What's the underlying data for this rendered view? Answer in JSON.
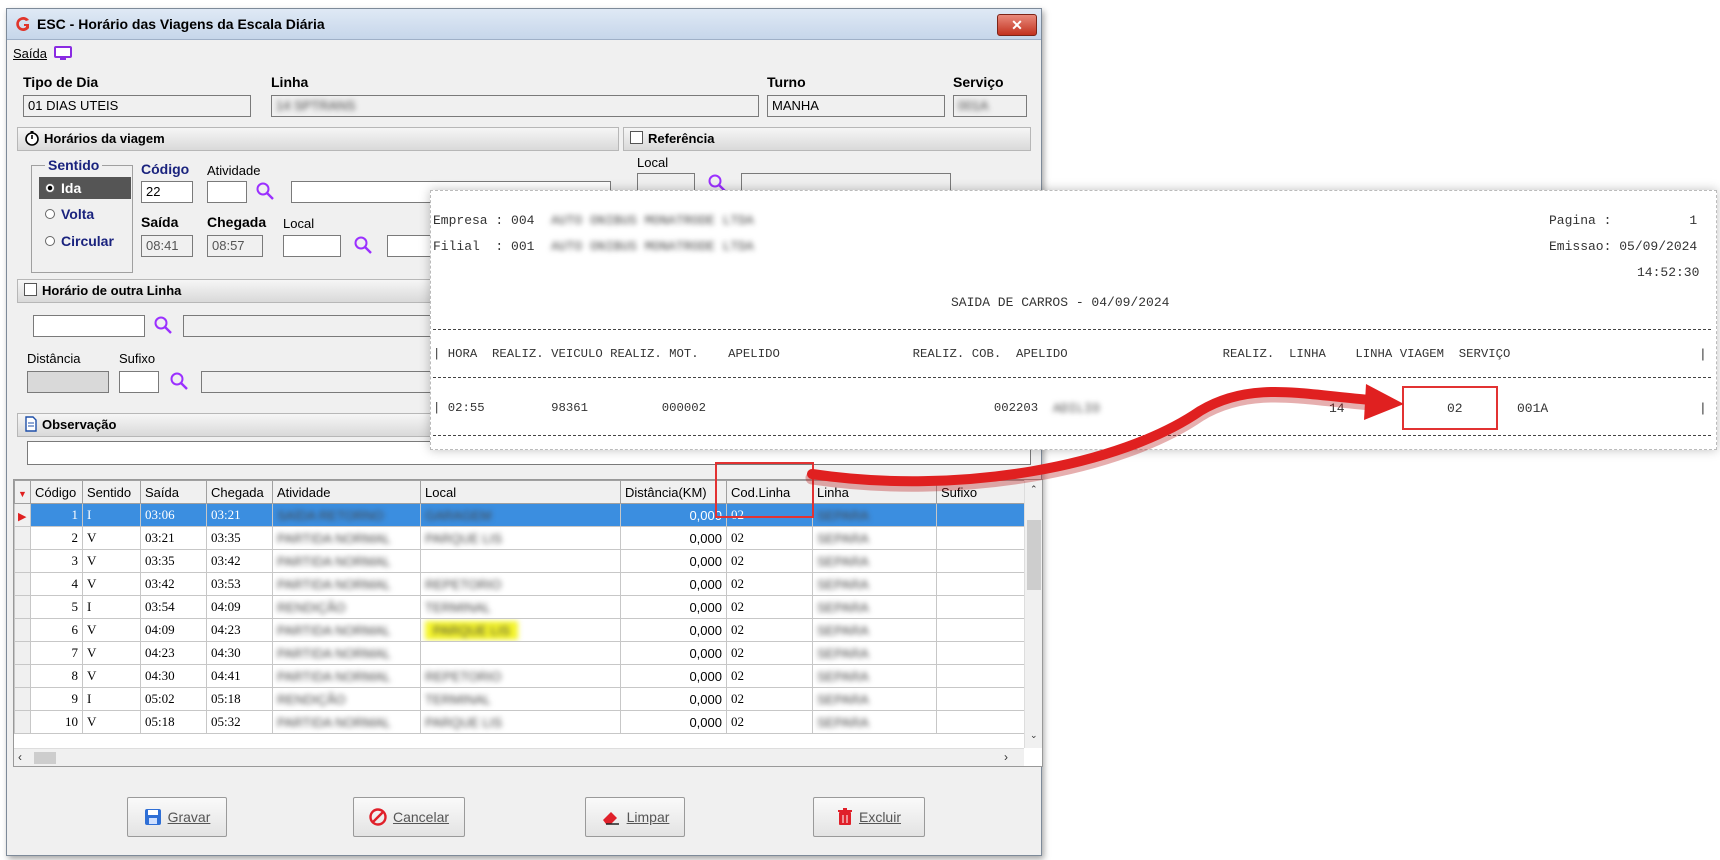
{
  "window": {
    "title": "ESC - Horário das Viagens da Escala Diária",
    "close_label": "✕"
  },
  "menu": {
    "saida_label": "Saída"
  },
  "header": {
    "tipo_dia_label": "Tipo de Dia",
    "tipo_dia_value": "01 DIAS UTEIS",
    "linha_label": "Linha",
    "linha_value": "14 SPTRANS",
    "turno_label": "Turno",
    "turno_value": "MANHA",
    "servico_label": "Serviço",
    "servico_value": "001A"
  },
  "horarios": {
    "title": "Horários da viagem",
    "sentido_label": "Sentido",
    "sentido_options": [
      "Ida",
      "Volta",
      "Circular"
    ],
    "codigo_label": "Código",
    "codigo_value": "22",
    "atividade_label": "Atividade",
    "saida_label": "Saída",
    "saida_value": "08:41",
    "chegada_label": "Chegada",
    "chegada_value": "08:57",
    "local_label": "Local"
  },
  "referencia": {
    "title": "Referência",
    "local_label": "Local"
  },
  "outra_linha": {
    "title": "Horário de outra Linha",
    "distancia_label": "Distância",
    "sufixo_label": "Sufixo"
  },
  "observacao": {
    "title": "Observação"
  },
  "grid": {
    "columns": [
      "Código",
      "Sentido",
      "Saída",
      "Chegada",
      "Atividade",
      "Local",
      "Distância(KM)",
      "Cod.Linha",
      "Linha",
      "Sufixo"
    ],
    "rows": [
      {
        "codigo": "1",
        "sentido": "I",
        "saida": "03:06",
        "chegada": "03:21",
        "atividade": "SAÍDA RETORNO",
        "local": "GARAGEM",
        "distancia": "0,000",
        "cod_linha": "02",
        "linha": "SEPARA"
      },
      {
        "codigo": "2",
        "sentido": "V",
        "saida": "03:21",
        "chegada": "03:35",
        "atividade": "PARTIDA NORMAL",
        "local": "PARQUE LIS",
        "distancia": "0,000",
        "cod_linha": "02",
        "linha": "SEPARA"
      },
      {
        "codigo": "3",
        "sentido": "V",
        "saida": "03:35",
        "chegada": "03:42",
        "atividade": "PARTIDA NORMAL",
        "local": "",
        "distancia": "0,000",
        "cod_linha": "02",
        "linha": "SEPARA"
      },
      {
        "codigo": "4",
        "sentido": "V",
        "saida": "03:42",
        "chegada": "03:53",
        "atividade": "PARTIDA NORMAL",
        "local": "REPETORIO",
        "distancia": "0,000",
        "cod_linha": "02",
        "linha": "SEPARA"
      },
      {
        "codigo": "5",
        "sentido": "I",
        "saida": "03:54",
        "chegada": "04:09",
        "atividade": "RENDIÇÃO",
        "local": "TERMINAL",
        "distancia": "0,000",
        "cod_linha": "02",
        "linha": "SEPARA"
      },
      {
        "codigo": "6",
        "sentido": "V",
        "saida": "04:09",
        "chegada": "04:23",
        "atividade": "PARTIDA NORMAL",
        "local": "PARQUE LIS",
        "distancia": "0,000",
        "cod_linha": "02",
        "linha": "SEPARA"
      },
      {
        "codigo": "7",
        "sentido": "V",
        "saida": "04:23",
        "chegada": "04:30",
        "atividade": "PARTIDA NORMAL",
        "local": "",
        "distancia": "0,000",
        "cod_linha": "02",
        "linha": "SEPARA"
      },
      {
        "codigo": "8",
        "sentido": "V",
        "saida": "04:30",
        "chegada": "04:41",
        "atividade": "PARTIDA NORMAL",
        "local": "REPETORIO",
        "distancia": "0,000",
        "cod_linha": "02",
        "linha": "SEPARA"
      },
      {
        "codigo": "9",
        "sentido": "I",
        "saida": "05:02",
        "chegada": "05:18",
        "atividade": "RENDIÇÃO",
        "local": "TERMINAL",
        "distancia": "0,000",
        "cod_linha": "02",
        "linha": "SEPARA"
      },
      {
        "codigo": "10",
        "sentido": "V",
        "saida": "05:18",
        "chegada": "05:32",
        "atividade": "PARTIDA NORMAL",
        "local": "PARQUE LIS",
        "distancia": "0,000",
        "cod_linha": "02",
        "linha": "SEPARA"
      }
    ]
  },
  "buttons": {
    "gravar": "Gravar",
    "cancelar": "Cancelar",
    "limpar": "Limpar",
    "excluir": "Excluir"
  },
  "report": {
    "empresa": "Empresa : 004",
    "empresa_name": "AUTO ONIBUS MONATRODE LTDA",
    "filial": "Filial  : 001",
    "filial_name": "AUTO ONIBUS MONATRODE LTDA",
    "pagina": "Pagina :          1",
    "emissao": "Emissao: 05/09/2024",
    "hora": "14:52:30",
    "title": "SAIDA DE CARROS - 04/09/2024",
    "header_row": "| HORA  REALIZ. VEICULO REALIZ. MOT.    APELIDO                  REALIZ. COB.  APELIDO                     REALIZ.  LINHA    LINHA VIAGEM  SERVIÇO",
    "data_row": "| 02:55         98361          000002                                       002203",
    "data_apelido": "ADILIO",
    "data_linha": "14",
    "data_linha_viagem": "02",
    "data_servico": "001A",
    "pipe": "|"
  },
  "colors": {
    "highlight": "#e23232",
    "selection": "#3b8ee0",
    "arrow": "#e02020"
  }
}
